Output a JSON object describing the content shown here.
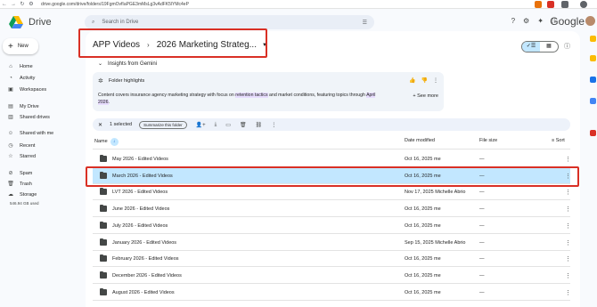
{
  "browser": {
    "url": "drive.google.com/drive/folders/19FgmOvfIaPGE3mMsLg3vAdFK5lYMc4eP"
  },
  "app": {
    "logo_text": "Drive"
  },
  "search": {
    "placeholder": "Search in Drive"
  },
  "header": {
    "google_word": "Google"
  },
  "sidebar": {
    "new_label": "New",
    "items": [
      {
        "label": "Home",
        "icon": "home-icon"
      },
      {
        "label": "Activity",
        "icon": "activity-icon"
      },
      {
        "label": "Workspaces",
        "icon": "workspaces-icon"
      },
      {
        "label": "My Drive",
        "icon": "my-drive-icon"
      },
      {
        "label": "Shared drives",
        "icon": "shared-drives-icon"
      },
      {
        "label": "Shared with me",
        "icon": "shared-with-me-icon"
      },
      {
        "label": "Recent",
        "icon": "clock-icon"
      },
      {
        "label": "Starred",
        "icon": "star-icon"
      },
      {
        "label": "Spam",
        "icon": "spam-icon"
      },
      {
        "label": "Trash",
        "icon": "trash-icon"
      },
      {
        "label": "Storage",
        "icon": "cloud-icon"
      }
    ],
    "storage_used": "546.94 GB used"
  },
  "breadcrumb": {
    "parent": "APP Videos",
    "current": "2026 Marketing Strateg..."
  },
  "insights": {
    "title": "Insights from Gemini",
    "highlights_title": "Folder highlights",
    "body_1": "Content covers insurance agency marketing strategy with focus on ",
    "body_em_1": "retention tactics",
    "body_2": " and market conditions, featuring topics through ",
    "body_em_2": "April 2026",
    "body_3": ".",
    "see_more": "See more"
  },
  "selection": {
    "count_label": "1 selected",
    "summarize_label": "Summarize this folder"
  },
  "columns": {
    "name": "Name",
    "date": "Date modified",
    "size": "File size",
    "sort": "Sort"
  },
  "rows": [
    {
      "name": "May 2026 - Edited Videos",
      "date": "Oct 16, 2025 me",
      "size": "—"
    },
    {
      "name": "March 2026 - Edited Videos",
      "date": "Oct 16, 2025 me",
      "size": "—"
    },
    {
      "name": "LVT 2026 - Edited Videos",
      "date": "Nov 17, 2025 Michelle Abrio",
      "size": "—"
    },
    {
      "name": "June 2026 - Edited Videos",
      "date": "Oct 16, 2025 me",
      "size": "—"
    },
    {
      "name": "July 2026 - Edited Videos",
      "date": "Oct 16, 2025 me",
      "size": "—"
    },
    {
      "name": "January 2026 - Edited Videos",
      "date": "Sep 15, 2025 Michelle Abrio",
      "size": "—"
    },
    {
      "name": "February 2026 - Edited Videos",
      "date": "Oct 16, 2025 me",
      "size": "—"
    },
    {
      "name": "December 2026 - Edited Videos",
      "date": "Oct 16, 2025 me",
      "size": "—"
    },
    {
      "name": "August 2026 - Edited Videos",
      "date": "Oct 16, 2025 me",
      "size": "—"
    }
  ],
  "colors": {
    "selected_row": "#c2e7ff",
    "annotation_red": "#d93025",
    "accent_blue": "#0b57d0"
  }
}
